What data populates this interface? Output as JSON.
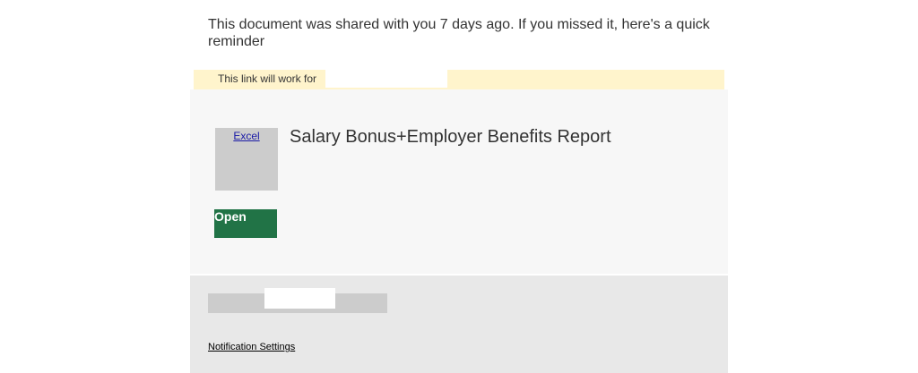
{
  "intro": {
    "message": "This document was shared with you 7 days ago. If you missed it, here's a quick reminder"
  },
  "expiry": {
    "label": "This link will work for",
    "value": ""
  },
  "document": {
    "app_label": "Excel",
    "title": "Salary Bonus+Employer Benefits Report",
    "open_label": "Open"
  },
  "footer": {
    "notification_settings": "Notification Settings"
  },
  "colors": {
    "banner_bg": "#fff4cc",
    "card_bg": "#f7f7f7",
    "footer_bg": "#e8e8e8",
    "open_button_bg": "#217346"
  }
}
